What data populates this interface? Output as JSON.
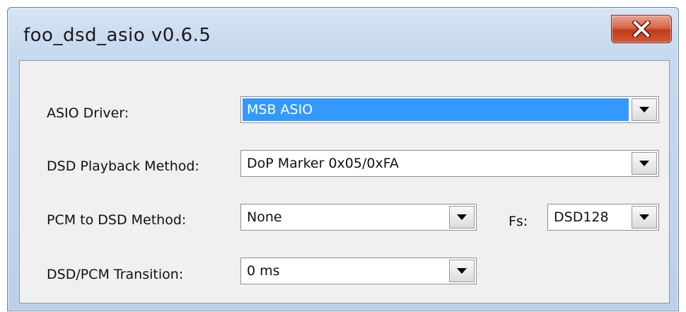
{
  "window": {
    "title": "foo_dsd_asio v0.6.5",
    "close_icon": "close-x-icon"
  },
  "form": {
    "asio_driver": {
      "label": "ASIO Driver:",
      "value": "MSB ASIO"
    },
    "playback_method": {
      "label": "DSD Playback Method:",
      "value": "DoP Marker 0x05/0xFA"
    },
    "pcm_to_dsd": {
      "label": "PCM to DSD Method:",
      "value": "None"
    },
    "fs": {
      "label": "Fs:",
      "value": "DSD128"
    },
    "transition": {
      "label": "DSD/PCM Transition:",
      "value": "0 ms"
    }
  },
  "colors": {
    "selection": "#3399ff",
    "close_button": "#c2391c"
  }
}
